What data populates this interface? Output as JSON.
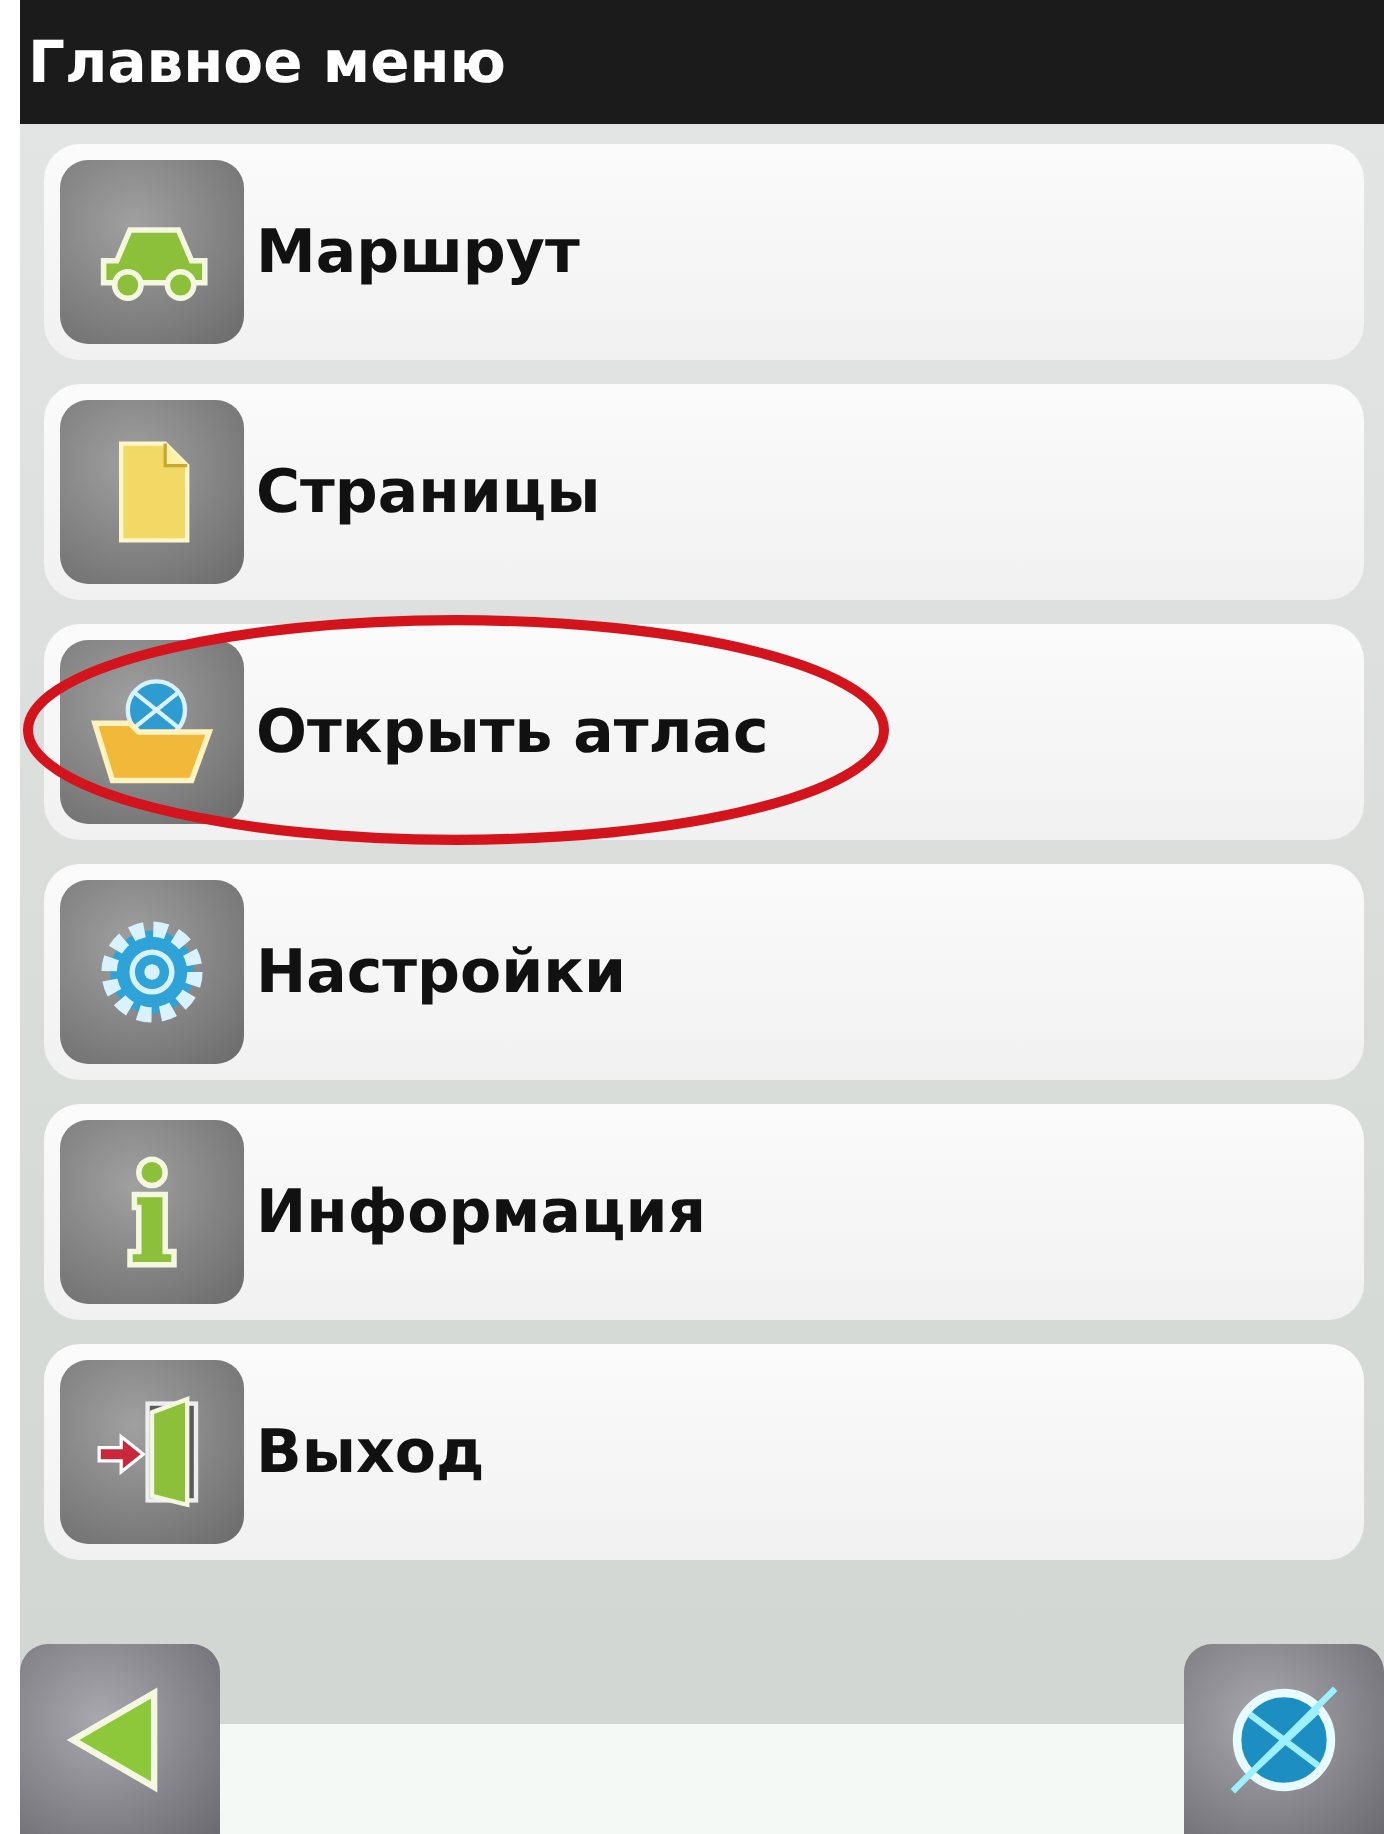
{
  "window": {
    "title": "Главное меню"
  },
  "menu": [
    {
      "label": "Маршрут",
      "kind": "car",
      "circled": false
    },
    {
      "label": "Страницы",
      "kind": "page",
      "circled": false
    },
    {
      "label": "Открыть атлас",
      "kind": "atlas",
      "circled": true
    },
    {
      "label": "Настройки",
      "kind": "gear",
      "circled": false
    },
    {
      "label": "Информация",
      "kind": "info",
      "circled": false
    },
    {
      "label": "Выход",
      "kind": "exit",
      "circled": false
    }
  ]
}
